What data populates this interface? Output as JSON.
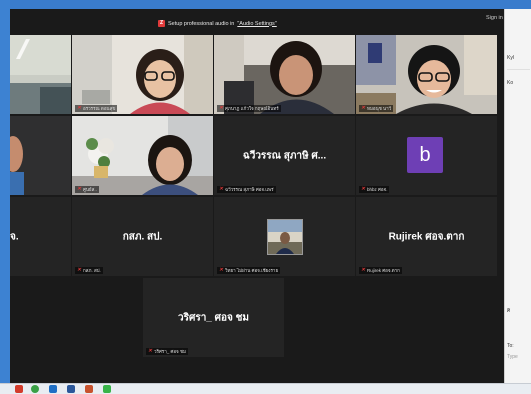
{
  "banner": {
    "text": "Setup professional audio in",
    "link": "\"Audio Settings\""
  },
  "header": {
    "signin": "Sign in"
  },
  "tiles": [
    {
      "id": "r1c1",
      "name": ""
    },
    {
      "id": "r1c2",
      "name": "อรวรรณ ตอนสุข"
    },
    {
      "id": "r1c3",
      "name": "ศุภนาฏ แก้วใจ กฤษณ์อินทร์"
    },
    {
      "id": "r1c4",
      "name": "หมอนุช นาวี"
    },
    {
      "id": "r2c1",
      "name": ""
    },
    {
      "id": "r2c2",
      "name": "ศูนย์ส.."
    },
    {
      "id": "r2c3",
      "big": "ฉวีวรรณ สุภาษิ ศ...",
      "name": "ฉวีวรรณ สุภาษิ ศอจ.แพร่"
    },
    {
      "id": "r2c4",
      "avatar": "b",
      "name": "bhbz ศอจ."
    },
    {
      "id": "r3c1",
      "big": "จ.",
      "name": ""
    },
    {
      "id": "r3c2",
      "big": "กสภ. สป.",
      "name": "กสภ. สป."
    },
    {
      "id": "r3c3",
      "name": "วิทยา ไม่ผ่าน ศอจ.เชียงราย"
    },
    {
      "id": "r3c4",
      "big": "Rujirek ศอจ.ตาก",
      "name": "Rujirek ศอจ.ตาก"
    },
    {
      "id": "r4c2",
      "big": "วริศรา_ ศอจ ชม",
      "name": "วริศรา_ ศอจ ชม"
    }
  ],
  "right_panel": {
    "items": [
      "Kyl",
      "Ko",
      "ศิ",
      "To:",
      "Type"
    ]
  },
  "colors": {
    "active_speaker": "#c5e43d",
    "muted_mic": "#e23a3a",
    "avatar_bg": "#6e3fb5"
  },
  "taskbar": {
    "icons": [
      "start-icon",
      "chrome-icon",
      "outlook-icon",
      "word-icon",
      "powerpoint-icon",
      "line-icon"
    ]
  }
}
